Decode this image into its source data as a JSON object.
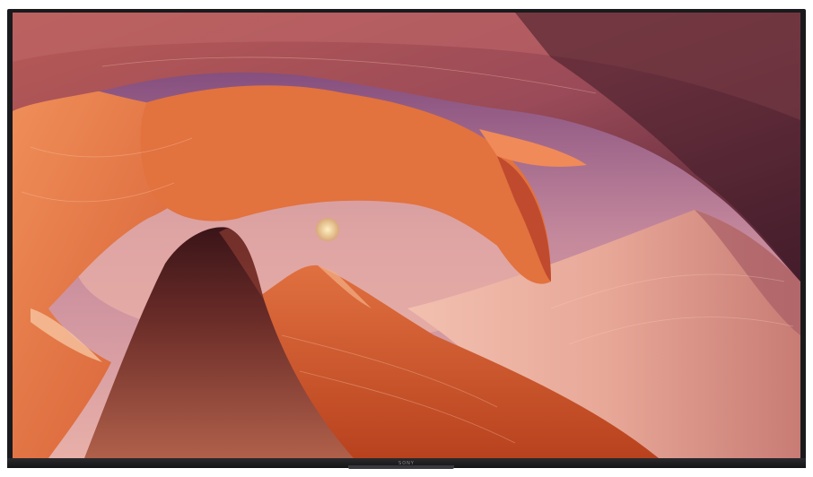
{
  "brand": "SONY",
  "scene": {
    "colors": {
      "bezel": "#1a1a1d",
      "sky_top": "#6e3a74",
      "sky_bottom": "#e0a0a8",
      "rock_orange": "#e8743a",
      "rock_dark": "#4a1e22",
      "moon": "#f4d49a"
    }
  }
}
